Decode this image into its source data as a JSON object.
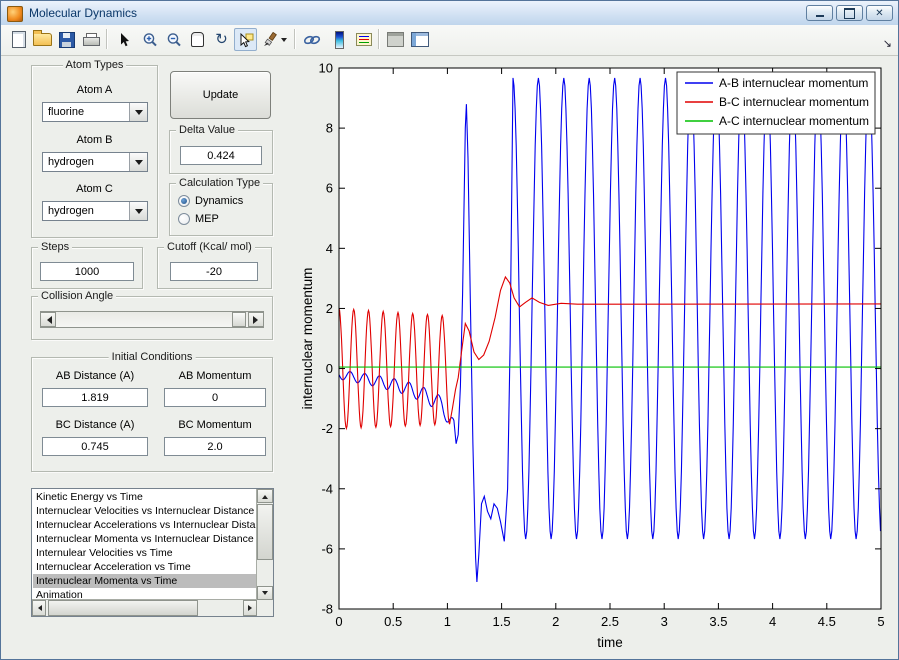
{
  "window": {
    "title": "Molecular Dynamics"
  },
  "toolbar": {
    "icons": [
      "new-document",
      "open-folder",
      "save",
      "print",
      "edit-plot-arrow",
      "zoom-in",
      "zoom-out",
      "pan-hand",
      "rotate-3d",
      "data-cursor",
      "brush",
      "brush-dropdown",
      "link-plot",
      "insert-colorbar",
      "insert-legend",
      "hide-plot-tools",
      "show-plot-tools-dock",
      "dock-figure-arrow"
    ],
    "active_icon": "data-cursor"
  },
  "controls": {
    "atom_types": {
      "title": "Atom Types",
      "atom_a_label": "Atom A",
      "atom_a_value": "fluorine",
      "atom_b_label": "Atom B",
      "atom_b_value": "hydrogen",
      "atom_c_label": "Atom C",
      "atom_c_value": "hydrogen"
    },
    "update_label": "Update",
    "delta": {
      "title": "Delta Value",
      "value": "0.424"
    },
    "calc_type": {
      "title": "Calculation Type",
      "options": [
        {
          "label": "Dynamics",
          "selected": true
        },
        {
          "label": "MEP",
          "selected": false
        }
      ]
    },
    "steps": {
      "title": "Steps",
      "value": "1000"
    },
    "cutoff": {
      "title": "Cutoff (Kcal/ mol)",
      "value": "-20"
    },
    "collision": {
      "title": "Collision Angle"
    },
    "initial": {
      "title": "Initial Conditions",
      "ab_distance_label": "AB Distance (A)",
      "ab_distance_value": "1.819",
      "ab_momentum_label": "AB Momentum",
      "ab_momentum_value": "0",
      "bc_distance_label": "BC Distance (A)",
      "bc_distance_value": "0.745",
      "bc_momentum_label": "BC Momentum",
      "bc_momentum_value": "2.0"
    },
    "plot_list": {
      "selected_index": 6,
      "items": [
        "Kinetic Energy vs Time",
        "Internuclear Velocities vs Internuclear Distance",
        "Internuclear Accelerations vs Internuclear Dista",
        "Internuclear Momenta vs Internuclear Distance",
        "Internulear Velocities vs Time",
        "Internuclear Acceleration vs Time",
        "Internuclear Momenta vs Time",
        "Animation"
      ]
    }
  },
  "chart_data": {
    "type": "line",
    "title": "",
    "xlabel": "time",
    "ylabel": "internuclear momentum",
    "xlim": [
      0,
      5
    ],
    "ylim": [
      -8,
      10
    ],
    "xticks": [
      0,
      0.5,
      1,
      1.5,
      2,
      2.5,
      3,
      3.5,
      4,
      4.5,
      5
    ],
    "yticks": [
      -8,
      -6,
      -4,
      -2,
      0,
      2,
      4,
      6,
      8,
      10
    ],
    "grid": false,
    "legend_position": "top-right",
    "series": [
      {
        "name": "A-B internuclear momentum",
        "color": "#0000ee",
        "segments": [
          {
            "type": "osc",
            "t0": 0,
            "t1": 1.06,
            "period": 0.136,
            "phase_deg": 90,
            "amp": [
              [
                0,
                0.15
              ],
              [
                1.06,
                0.28
              ]
            ],
            "base": [
              [
                0,
                -0.2
              ],
              [
                0.3,
                -0.38
              ],
              [
                0.6,
                -0.62
              ],
              [
                0.8,
                -0.9
              ],
              [
                0.95,
                -1.2
              ],
              [
                1.06,
                -2.0
              ]
            ]
          },
          {
            "type": "points",
            "pts": [
              [
                1.08,
                -2.5
              ],
              [
                1.1,
                -2.2
              ],
              [
                1.12,
                -0.6
              ],
              [
                1.14,
                2.5
              ],
              [
                1.165,
                8.0
              ],
              [
                1.175,
                8.8
              ],
              [
                1.19,
                7.0
              ],
              [
                1.21,
                2.5
              ],
              [
                1.235,
                -2.5
              ],
              [
                1.26,
                -6.3
              ],
              [
                1.272,
                -7.1
              ],
              [
                1.29,
                -6.2
              ],
              [
                1.315,
                -4.5
              ],
              [
                1.34,
                -4.25
              ],
              [
                1.37,
                -4.75
              ],
              [
                1.4,
                -5.0
              ],
              [
                1.43,
                -4.5
              ],
              [
                1.46,
                -4.65
              ],
              [
                1.49,
                -5.1
              ],
              [
                1.525,
                -5.75
              ],
              [
                1.555,
                -4.0
              ],
              [
                1.578,
                0.8
              ]
            ]
          },
          {
            "type": "osc",
            "t0": 1.605,
            "t1": 5.0,
            "period": 0.2345,
            "phase_deg": 0,
            "amp": [
              [
                1.605,
                7.67
              ],
              [
                5,
                7.67
              ]
            ],
            "base": [
              [
                1.605,
                2.0
              ],
              [
                5,
                2.0
              ]
            ]
          }
        ]
      },
      {
        "name": "B-C internuclear momentum",
        "color": "#e00000",
        "segments": [
          {
            "type": "osc",
            "t0": 0,
            "t1": 1.02,
            "period": 0.136,
            "phase_deg": 0,
            "amp": [
              [
                0,
                2.0
              ],
              [
                1.02,
                1.8
              ]
            ],
            "base": [
              [
                0,
                0
              ],
              [
                1.02,
                -0.05
              ]
            ]
          },
          {
            "type": "points",
            "pts": [
              [
                1.045,
                -1.35
              ],
              [
                1.075,
                -0.7
              ],
              [
                1.1,
                -0.3
              ],
              [
                1.13,
                0.55
              ],
              [
                1.165,
                1.5
              ],
              [
                1.2,
                1.25
              ],
              [
                1.245,
                0.55
              ],
              [
                1.29,
                0.3
              ],
              [
                1.335,
                0.45
              ],
              [
                1.385,
                0.9
              ],
              [
                1.44,
                1.7
              ],
              [
                1.49,
                2.6
              ],
              [
                1.535,
                3.05
              ],
              [
                1.575,
                2.85
              ],
              [
                1.615,
                2.35
              ],
              [
                1.665,
                2.05
              ],
              [
                1.72,
                2.2
              ],
              [
                1.78,
                2.35
              ],
              [
                1.85,
                2.2
              ],
              [
                1.93,
                2.1
              ],
              [
                2.05,
                2.17
              ],
              [
                2.2,
                2.14
              ],
              [
                5.0,
                2.15
              ]
            ]
          }
        ]
      },
      {
        "name": "A-C internuclear momentum",
        "color": "#00c000",
        "segments": [
          {
            "type": "points",
            "pts": [
              [
                0,
                0.05
              ],
              [
                5,
                0.05
              ]
            ]
          }
        ]
      }
    ]
  }
}
